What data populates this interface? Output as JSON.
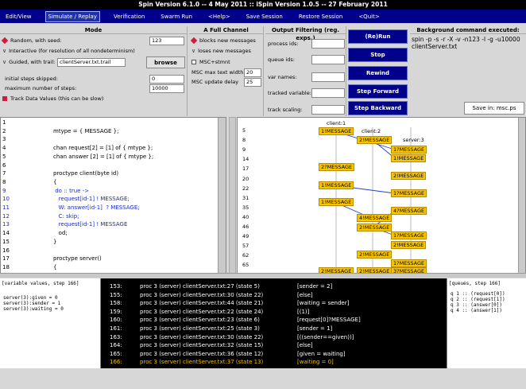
{
  "title": "Spin Version 6.1.0 -- 4 May 2011 :: iSpin Version 1.0.5 -- 27 February 2011",
  "menu": [
    "Edit/View",
    "Simulate / Replay",
    "Verification",
    "Swarm Run",
    "<Help>",
    "Save Session",
    "Restore Session",
    "<Quit>"
  ],
  "mode": {
    "header": "Mode",
    "random_label": "Random, with seed:",
    "seed_value": "123",
    "interactive_label": "Interactive (for resolution of all nondeterminism)",
    "guided_label": "Guided, with trail:",
    "trail_value": "clientServer.txt.trail",
    "browse_label": "browse",
    "skipped_label": "initial steps skipped:",
    "skipped_value": "0",
    "max_steps_label": "maximum number of steps:",
    "max_steps_value": "10000",
    "track_label": "Track Data Values (this can be slow)"
  },
  "channel": {
    "header": "A Full Channel",
    "blocks_label": "blocks new messages",
    "loses_label": "loses new messages",
    "msc_stmnt_label": "MSC+stmnt",
    "max_text_label": "MSC max text width",
    "max_text_value": "20",
    "update_label": "MSC update delay",
    "update_value": "25"
  },
  "filter": {
    "header": "Output Filtering (reg. exps.)",
    "process_label": "process ids:",
    "queue_label": "queue ids:",
    "var_label": "var names:",
    "tracked_label": "tracked variable:",
    "scaling_label": "track scaling:"
  },
  "controls": {
    "rerun": "(Re)Run",
    "stop": "Stop",
    "rewind": "Rewind",
    "step_forward": "Step Forward",
    "step_backward": "Step Backward"
  },
  "background": {
    "header": "Background command executed:",
    "command_line1": "spin -p -s -r -X -v -n123 -l -g -u10000",
    "command_line2": "clientServer.txt",
    "save_label": "Save in: msc.ps"
  },
  "code_lines": [
    {
      "n": "1",
      "t": "",
      "c": "black"
    },
    {
      "n": "2",
      "t": "mtype = { MESSAGE };",
      "c": "black"
    },
    {
      "n": "3",
      "t": "",
      "c": "black"
    },
    {
      "n": "4",
      "t": "chan request[2] = [1] of { mtype };",
      "c": "black"
    },
    {
      "n": "5",
      "t": "chan answer [2] = [1] of { mtype };",
      "c": "black"
    },
    {
      "n": "6",
      "t": "",
      "c": "black"
    },
    {
      "n": "7",
      "t": "proctype client(byte id)",
      "c": "black"
    },
    {
      "n": "8",
      "t": "{",
      "c": "black"
    },
    {
      "n": "9",
      "t": " do :: true ->",
      "c": "blue"
    },
    {
      "n": "10",
      "t": "   request[id-1] ! MESSAGE;",
      "c": "blue"
    },
    {
      "n": "11",
      "t": "   W: answer[id-1]  ? MESSAGE;",
      "c": "blue"
    },
    {
      "n": "12",
      "t": "   C: skip;",
      "c": "blue"
    },
    {
      "n": "13",
      "t": "   request[id-1] ! MESSAGE",
      "c": "blue"
    },
    {
      "n": "14",
      "t": "   od;",
      "c": "black"
    },
    {
      "n": "15",
      "t": "}",
      "c": "black"
    },
    {
      "n": "16",
      "t": "",
      "c": "black"
    },
    {
      "n": "17",
      "t": "proctype server()",
      "c": "black"
    },
    {
      "n": "18",
      "t": "{",
      "c": "black"
    }
  ],
  "msc": {
    "labels": [
      "client:1",
      "client:2",
      "server:3"
    ],
    "steps": [
      "5",
      "8",
      "9",
      "14",
      "17",
      "20",
      "22",
      "31",
      "35",
      "40",
      "46",
      "49",
      "57",
      "62",
      "65"
    ],
    "boxes": [
      "1!MESSAGE",
      "2!MESSAGE",
      "1?MESSAGE",
      "1!MESSAGE",
      "2?MESSAGE",
      "2!MESSAGE",
      "1!MESSAGE",
      "1?MESSAGE",
      "1!MESSAGE",
      "4!MESSAGE",
      "4?MESSAGE",
      "2!MESSAGE",
      "1?MESSAGE",
      "2!MESSAGE",
      "2!MESSAGE",
      "1?MESSAGE",
      "2!MESSAGE",
      "3?MESSAGE",
      "2!MESSAGE"
    ]
  },
  "vars": {
    "header": "[variable values, step 166]",
    "lines": [
      "server(3):given = 0",
      "server(3):sender = 1",
      "server(3):waiting = 0"
    ]
  },
  "trace": [
    {
      "n": "153:",
      "p": "proc 3 (server) clientServer.txt:27 (state 5)",
      "s": "[sender = 2]",
      "hl": false
    },
    {
      "n": "155:",
      "p": "proc 3 (server) clientServer.txt:30 (state 22)",
      "s": "[else]",
      "hl": false
    },
    {
      "n": "158:",
      "p": "proc 3 (server) clientServer.txt:44 (state 21)",
      "s": "[waiting = sender]",
      "hl": false
    },
    {
      "n": "159:",
      "p": "proc 3 (server) clientServer.txt:22 (state 24)",
      "s": "[(1)]",
      "hl": false
    },
    {
      "n": "160:",
      "p": "proc 3 (server) clientServer.txt:23 (state 6)",
      "s": "[request[0]?MESSAGE]",
      "hl": false
    },
    {
      "n": "161:",
      "p": "proc 3 (server) clientServer.txt:25 (state 3)",
      "s": "[sender = 1]",
      "hl": false
    },
    {
      "n": "163:",
      "p": "proc 3 (server) clientServer.txt:30 (state 22)",
      "s": "[((sender==given))]",
      "hl": false
    },
    {
      "n": "164:",
      "p": "proc 3 (server) clientServer.txt:32 (state 15)",
      "s": "[else]",
      "hl": false
    },
    {
      "n": "165:",
      "p": "proc 3 (server) clientServer.txt:36 (state 12)",
      "s": "[given = waiting]",
      "hl": false
    },
    {
      "n": "166:",
      "p": "proc 3 (server) clientServer.txt:37 (state 13)",
      "s": "[waiting = 0]",
      "hl": true
    }
  ],
  "queues": {
    "header": "[queues, step 166]",
    "lines": [
      "q 1 :: (request[0])",
      "q 2 :: (request[1])",
      "q 3 :: (answer[0])",
      "q 4 :: (answer[1])"
    ]
  }
}
